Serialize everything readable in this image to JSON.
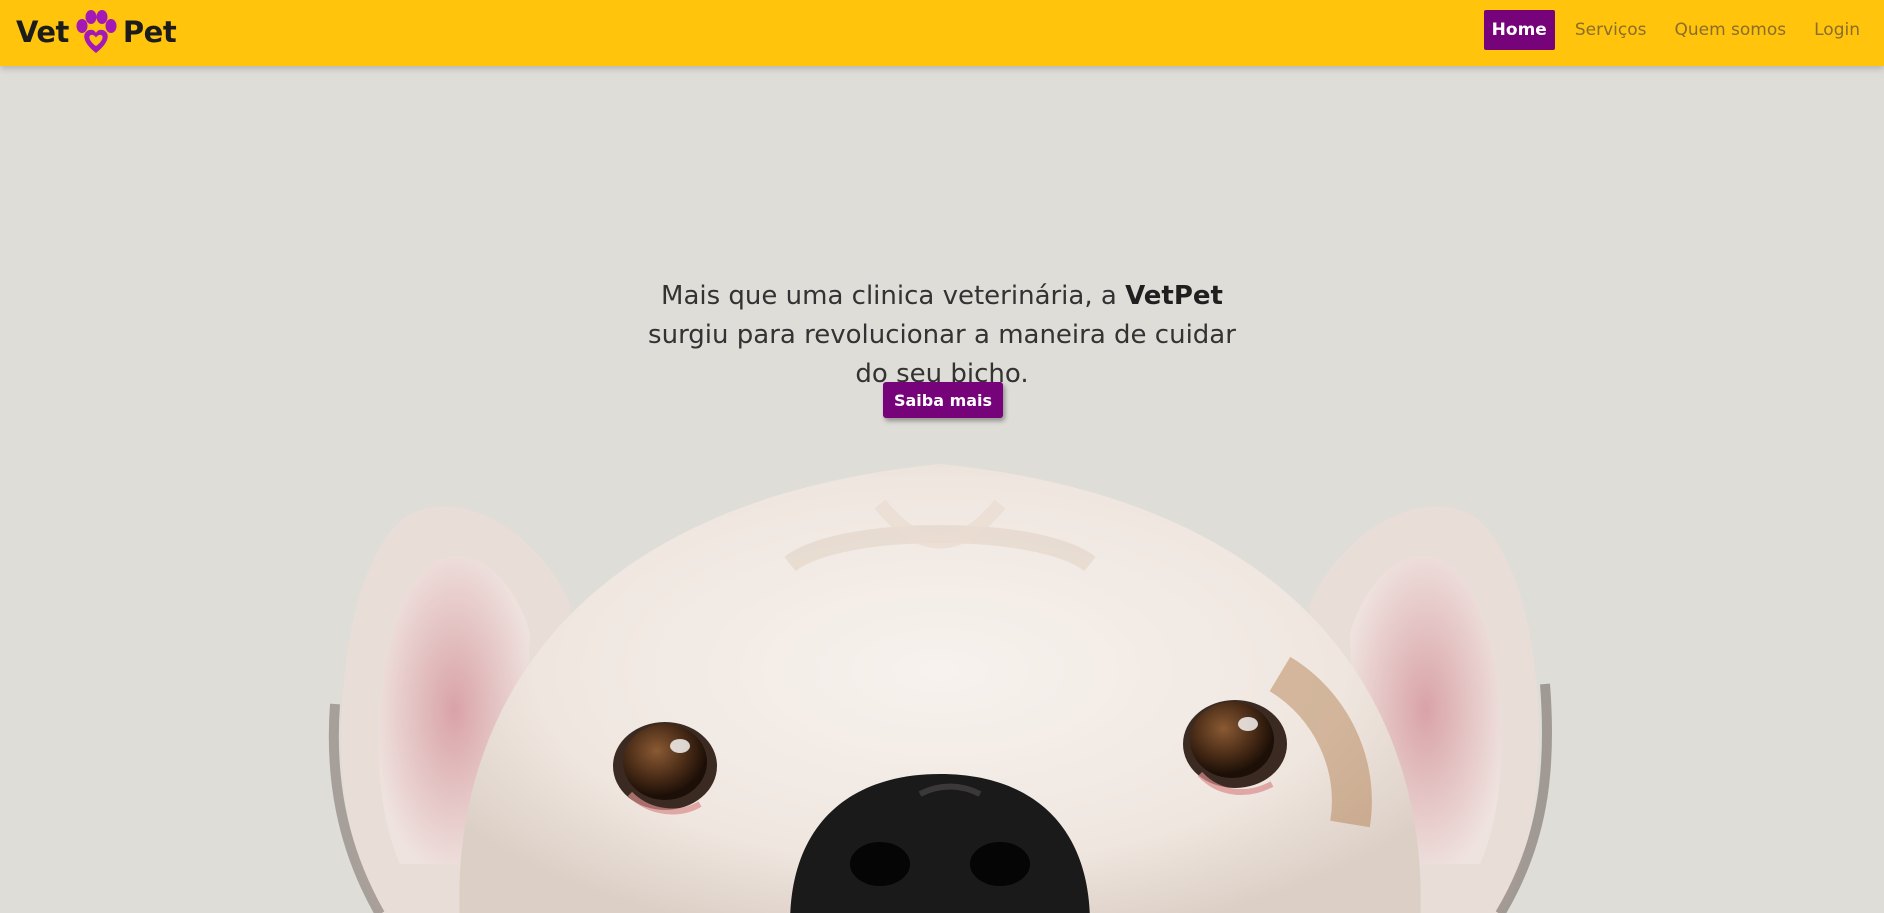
{
  "header": {
    "logo": {
      "left": "Vet",
      "right": "Pet"
    },
    "nav": [
      {
        "label": "Home",
        "active": true
      },
      {
        "label": "Serviços",
        "active": false
      },
      {
        "label": "Quem somos",
        "active": false
      },
      {
        "label": "Login",
        "active": false
      }
    ]
  },
  "hero": {
    "text_before": "Mais que uma clinica veterinária, a ",
    "text_brand": "VetPet",
    "text_after": " surgiu para revolucionar a maneira de cuidar do seu bicho.",
    "cta_label": "Saiba mais",
    "image_icon": "bulldog-photo"
  },
  "colors": {
    "header_bg": "#ffc40b",
    "accent_purple": "#77037b",
    "page_bg": "#dfddd8"
  }
}
